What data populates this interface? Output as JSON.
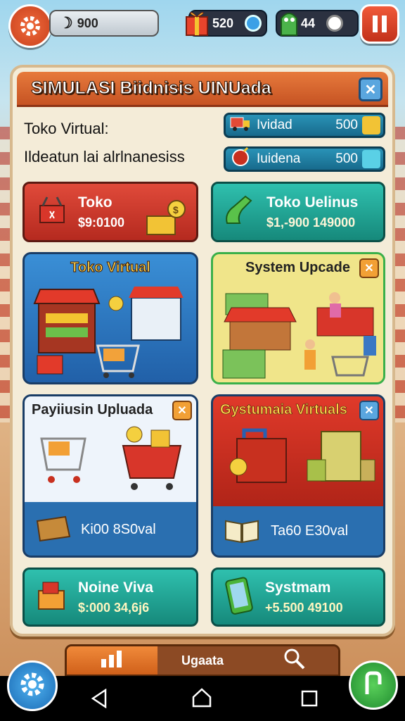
{
  "colors": {
    "accent": "#e0622a",
    "teal": "#1fa596",
    "red": "#c83326",
    "blue": "#2a78c4"
  },
  "topbar": {
    "coins": "900",
    "gifts": "520",
    "gems": "44"
  },
  "panel": {
    "title": "SIMULASI Biidnisis UINUada",
    "subtitle1": "Toko Virtual:",
    "subtitle2": "Ildeatun lai alrlnanesiss",
    "stats": [
      {
        "label": "Ividad",
        "value": "500",
        "icon": "truck-icon"
      },
      {
        "label": "Iuidena",
        "value": "500",
        "icon": "bomb-icon"
      }
    ]
  },
  "buttons": {
    "toko": {
      "title": "Toko",
      "amount": "$9:0100"
    },
    "toko_online": {
      "title": "Toko Uelinus",
      "amount": "$1,-900 149000"
    }
  },
  "cards": {
    "toko_virtual": {
      "title": "Toko Virtual"
    },
    "system_upgrade": {
      "title": "System Upcade"
    },
    "payment_upgrade": {
      "title": "Payiiusin Upluada",
      "footer": "Ki00 8S0val"
    },
    "system_virtual": {
      "title": "Gystumaia Virtuals",
      "footer": "Ta60 E30val"
    }
  },
  "bottom_buttons": {
    "online": {
      "title": "Noine Viva",
      "amount": "$:000 34,6j6"
    },
    "system": {
      "title": "Systmam",
      "amount": "+5.500 49100"
    }
  },
  "nav": {
    "tabs": [
      "",
      "Ugaata",
      ""
    ]
  }
}
